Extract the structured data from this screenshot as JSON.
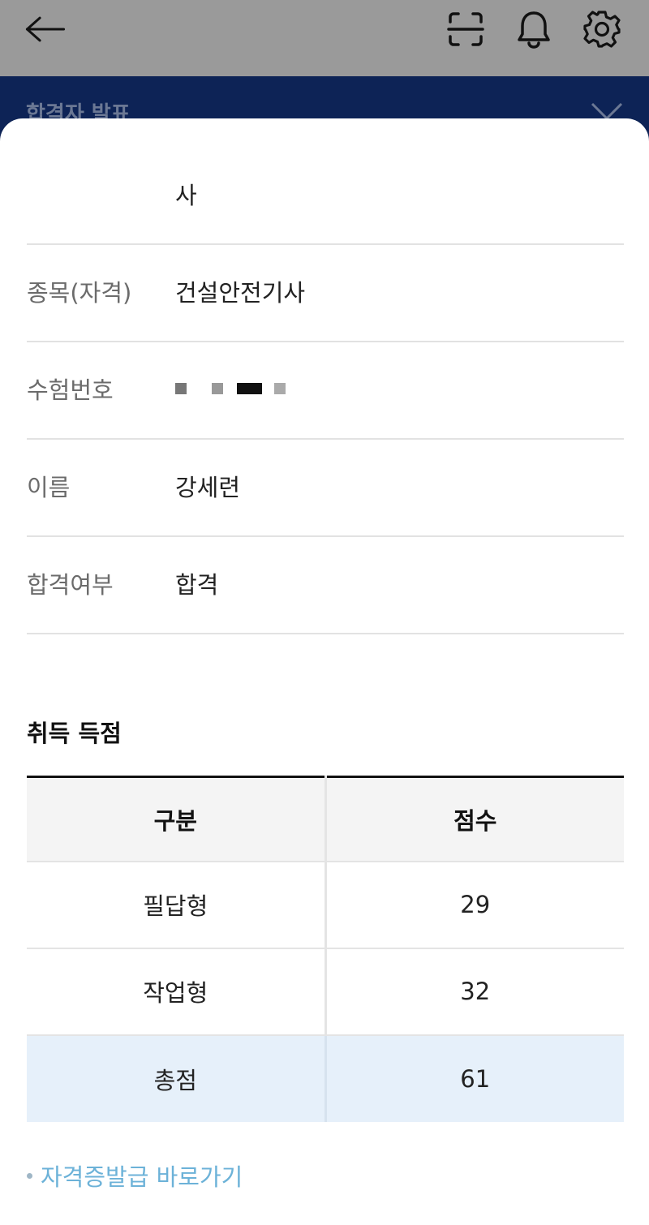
{
  "appbar": {
    "icons": [
      "back-arrow-icon",
      "scan-icon",
      "bell-icon",
      "gear-icon"
    ]
  },
  "subheader": {
    "title": "합격자 발표"
  },
  "info": {
    "row0_value": "사",
    "item_label": "종목(자격)",
    "item_value": "건설안전기사",
    "exam_no_label": "수험번호",
    "name_label": "이름",
    "name_value": "강세련",
    "pass_label": "합격여부",
    "pass_value": "합격"
  },
  "scores": {
    "title": "취득 득점",
    "headers": [
      "구분",
      "점수"
    ],
    "rows": [
      {
        "category": "필답형",
        "score": "29"
      },
      {
        "category": "작업형",
        "score": "32"
      },
      {
        "category": "총점",
        "score": "61"
      }
    ]
  },
  "link": {
    "label": "자격증발급 바로가기"
  },
  "colors": {
    "header_navy": "#0d2356",
    "total_row_bg": "#e6f0fa",
    "link": "#6cb2d8"
  }
}
